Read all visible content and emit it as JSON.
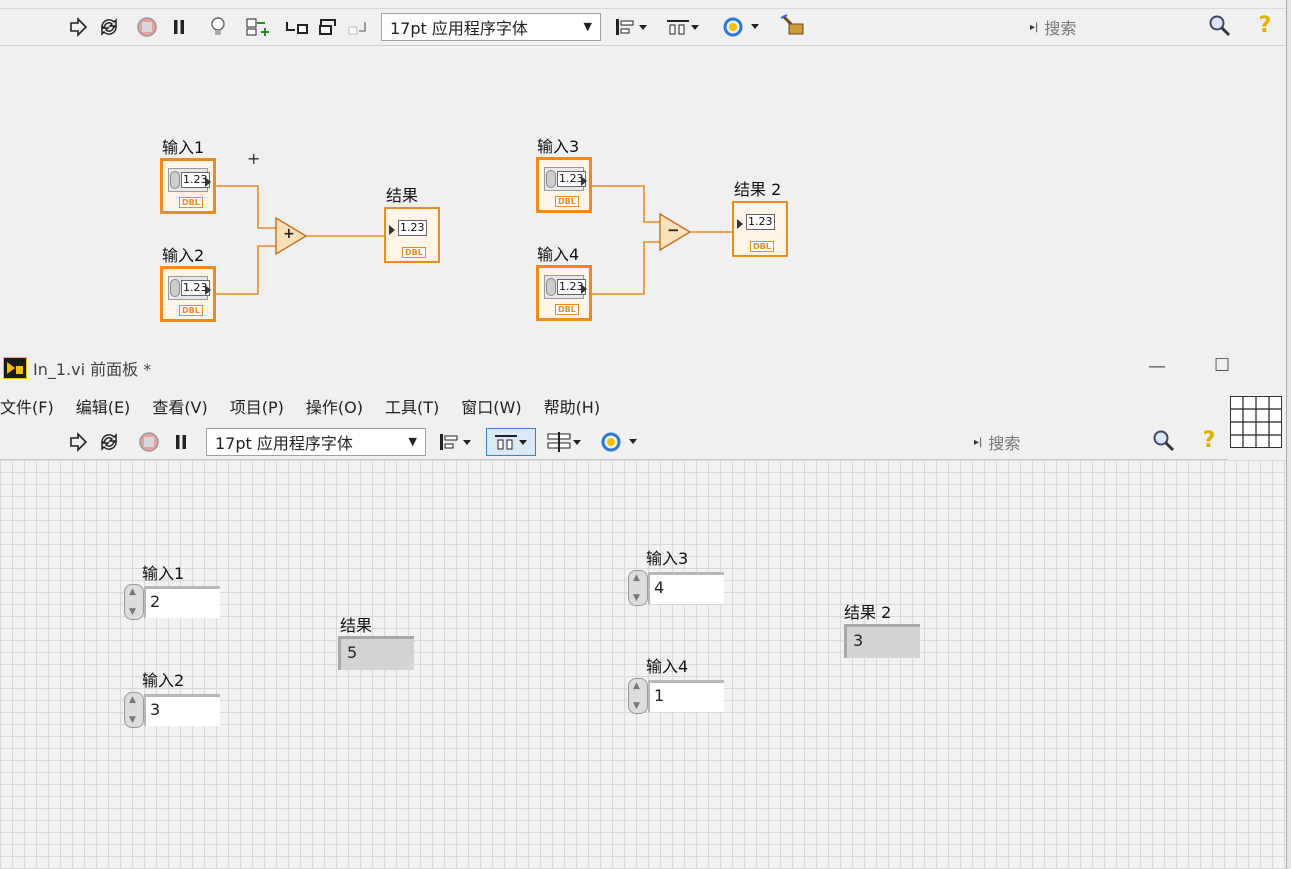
{
  "block_diagram": {
    "toolbar": {
      "font_select": "17pt 应用程序字体",
      "search_placeholder": "搜索",
      "help_glyph": "?"
    },
    "terminals": {
      "in1": {
        "label": "输入1",
        "value": "1.23",
        "type": "DBL"
      },
      "in2": {
        "label": "输入2",
        "value": "1.23",
        "type": "DBL"
      },
      "out1": {
        "label": "结果",
        "value": "1.23",
        "type": "DBL"
      },
      "in3": {
        "label": "输入3",
        "value": "1.23",
        "type": "DBL"
      },
      "in4": {
        "label": "输入4",
        "value": "1.23",
        "type": "DBL"
      },
      "out2": {
        "label": "结果 2",
        "value": "1.23",
        "type": "DBL"
      }
    },
    "nodes": {
      "add_symbol": "+",
      "subtract_symbol": "−"
    },
    "cursor": "+"
  },
  "front_panel": {
    "title": "In_1.vi 前面板 *",
    "window_controls": {
      "minimize": "—",
      "maximize": "☐"
    },
    "menu": [
      "文件(F)",
      "编辑(E)",
      "查看(V)",
      "项目(P)",
      "操作(O)",
      "工具(T)",
      "窗口(W)",
      "帮助(H)"
    ],
    "toolbar": {
      "font_select": "17pt 应用程序字体",
      "search_placeholder": "搜索",
      "help_glyph": "?"
    },
    "controls": {
      "in1": {
        "label": "输入1",
        "value": "2"
      },
      "in2": {
        "label": "输入2",
        "value": "3"
      },
      "in3": {
        "label": "输入3",
        "value": "4"
      },
      "in4": {
        "label": "输入4",
        "value": "1"
      }
    },
    "indicators": {
      "out1": {
        "label": "结果",
        "value": "5"
      },
      "out2": {
        "label": "结果 2",
        "value": "3"
      }
    }
  },
  "colors": {
    "wire": "#f08a1c",
    "terminal_fill": "#fff4e6",
    "grid": "#d8d8d8"
  }
}
